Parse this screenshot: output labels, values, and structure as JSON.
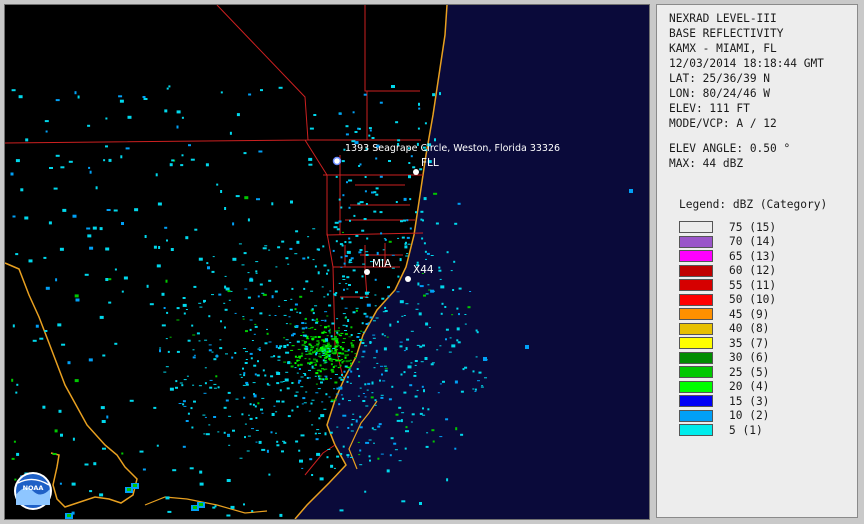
{
  "info": {
    "product": "NEXRAD LEVEL-III",
    "type": "BASE REFLECTIVITY",
    "station": "KAMX - MIAMI, FL",
    "datetime": "12/03/2014 18:18:44 GMT",
    "lat": "LAT: 25/36/39 N",
    "lon": "LON: 80/24/46 W",
    "elev": "ELEV: 111 FT",
    "mode": "MODE/VCP: A / 12",
    "elev_angle": "ELEV ANGLE: 0.50 °",
    "max": "MAX: 44 dBZ"
  },
  "legend": {
    "title": "Legend: dBZ (Category)",
    "items": [
      {
        "label": "75  (15)",
        "color": "#ececec"
      },
      {
        "label": "70  (14)",
        "color": "#9a55c9"
      },
      {
        "label": "65  (13)",
        "color": "#ff00ff"
      },
      {
        "label": "60  (12)",
        "color": "#c00000"
      },
      {
        "label": "55  (11)",
        "color": "#d60000"
      },
      {
        "label": "50  (10)",
        "color": "#ff0000"
      },
      {
        "label": "45  (9)",
        "color": "#ff9000"
      },
      {
        "label": "40  (8)",
        "color": "#e7c000"
      },
      {
        "label": "35  (7)",
        "color": "#ffff00"
      },
      {
        "label": "30  (6)",
        "color": "#008c00"
      },
      {
        "label": "25  (5)",
        "color": "#00c800"
      },
      {
        "label": "20  (4)",
        "color": "#00ff00"
      },
      {
        "label": "15  (3)",
        "color": "#0000f6"
      },
      {
        "label": "10  (2)",
        "color": "#01a0f6"
      },
      {
        "label": "5  (1)",
        "color": "#00ecec"
      }
    ]
  },
  "map": {
    "address": "1393 Seagrape Circle, Weston, Florida 33326",
    "fll": "FLL",
    "mia": "MIA",
    "x44": "X44",
    "logo": "NOAA"
  }
}
